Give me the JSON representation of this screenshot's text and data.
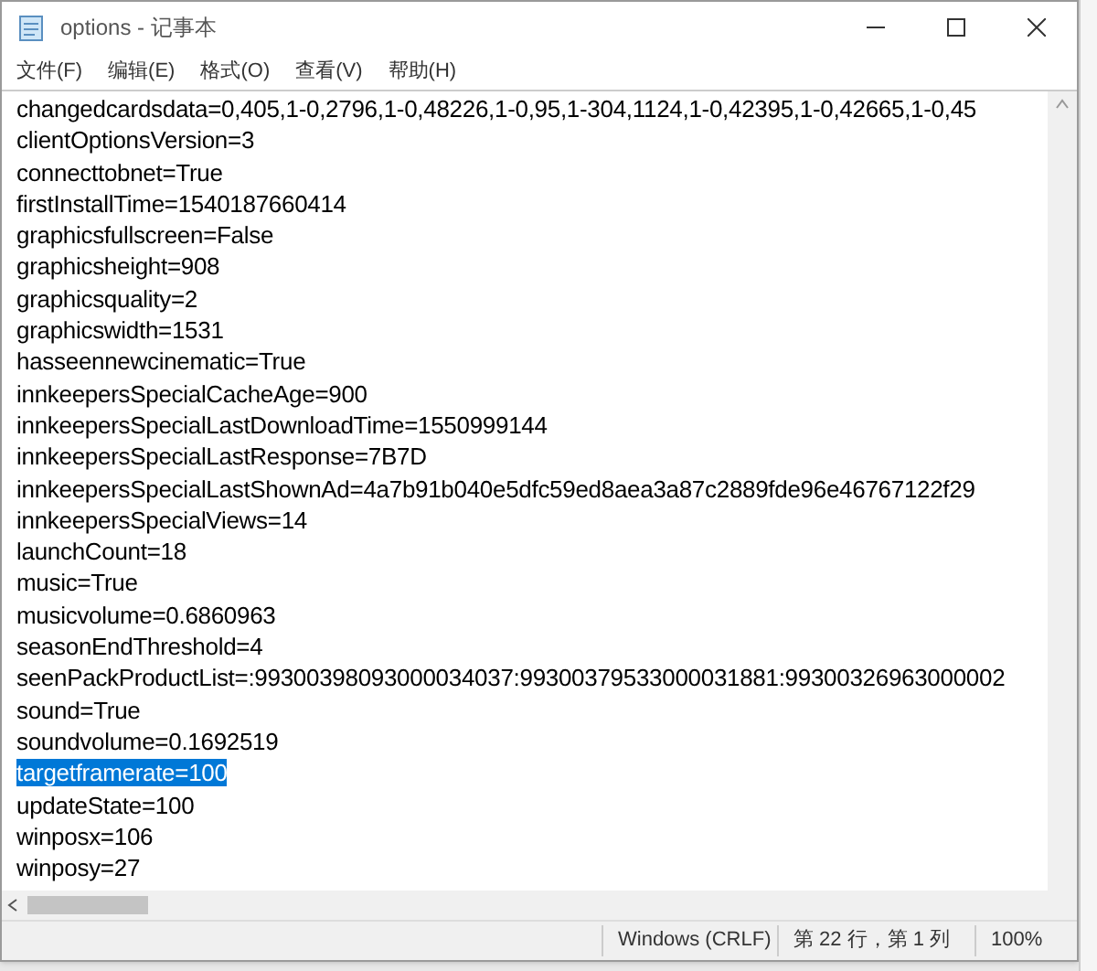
{
  "window": {
    "title": "options - 记事本"
  },
  "menu": [
    "文件(F)",
    "编辑(E)",
    "格式(O)",
    "查看(V)",
    "帮助(H)"
  ],
  "lines": [
    {
      "text": "changedcardsdata=0,405,1-0,2796,1-0,48226,1-0,95,1-304,1124,1-0,42395,1-0,42665,1-0,45",
      "selected": false
    },
    {
      "text": "clientOptionsVersion=3",
      "selected": false
    },
    {
      "text": "connecttobnet=True",
      "selected": false
    },
    {
      "text": "firstInstallTime=1540187660414",
      "selected": false
    },
    {
      "text": "graphicsfullscreen=False",
      "selected": false
    },
    {
      "text": "graphicsheight=908",
      "selected": false
    },
    {
      "text": "graphicsquality=2",
      "selected": false
    },
    {
      "text": "graphicswidth=1531",
      "selected": false
    },
    {
      "text": "hasseennewcinematic=True",
      "selected": false
    },
    {
      "text": "innkeepersSpecialCacheAge=900",
      "selected": false
    },
    {
      "text": "innkeepersSpecialLastDownloadTime=1550999144",
      "selected": false
    },
    {
      "text": "innkeepersSpecialLastResponse=7B7D",
      "selected": false
    },
    {
      "text": "innkeepersSpecialLastShownAd=4a7b91b040e5dfc59ed8aea3a87c2889fde96e46767122f29",
      "selected": false
    },
    {
      "text": "innkeepersSpecialViews=14",
      "selected": false
    },
    {
      "text": "launchCount=18",
      "selected": false
    },
    {
      "text": "music=True",
      "selected": false
    },
    {
      "text": "musicvolume=0.6860963",
      "selected": false
    },
    {
      "text": "seasonEndThreshold=4",
      "selected": false
    },
    {
      "text": "seenPackProductList=:99300398093000034037:99300379533000031881:99300326963000002",
      "selected": false
    },
    {
      "text": "sound=True",
      "selected": false
    },
    {
      "text": "soundvolume=0.1692519",
      "selected": false
    },
    {
      "text": "targetframerate=100",
      "selected": true
    },
    {
      "text": "updateState=100",
      "selected": false
    },
    {
      "text": "winposx=106",
      "selected": false
    },
    {
      "text": "winposy=27",
      "selected": false
    }
  ],
  "status_bar": [
    "Windows (CRLF)",
    "第 22 行，第 1 列",
    "100%"
  ]
}
